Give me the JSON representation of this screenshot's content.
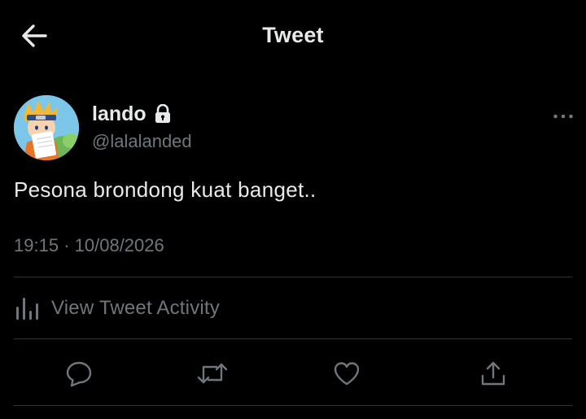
{
  "header": {
    "title": "Tweet",
    "back_icon": "arrow-left-icon"
  },
  "author": {
    "display_name": "lando",
    "handle": "@lalalanded",
    "protected_icon": "lock-icon",
    "avatar_icon": "anime-avatar"
  },
  "tweet": {
    "text": "Pesona brondong kuat banget..",
    "time": "19:15",
    "separator": "·",
    "date": "10/08/2026"
  },
  "activity": {
    "label": "View Tweet Activity",
    "icon": "analytics-bars-icon"
  },
  "actions": {
    "reply_icon": "reply-bubble-icon",
    "retweet_icon": "retweet-icon",
    "like_icon": "heart-icon",
    "share_icon": "share-upload-icon"
  },
  "colors": {
    "background": "#000000",
    "primary_text": "#e7e9ea",
    "secondary_text": "#71767b",
    "divider": "#2f3336"
  }
}
